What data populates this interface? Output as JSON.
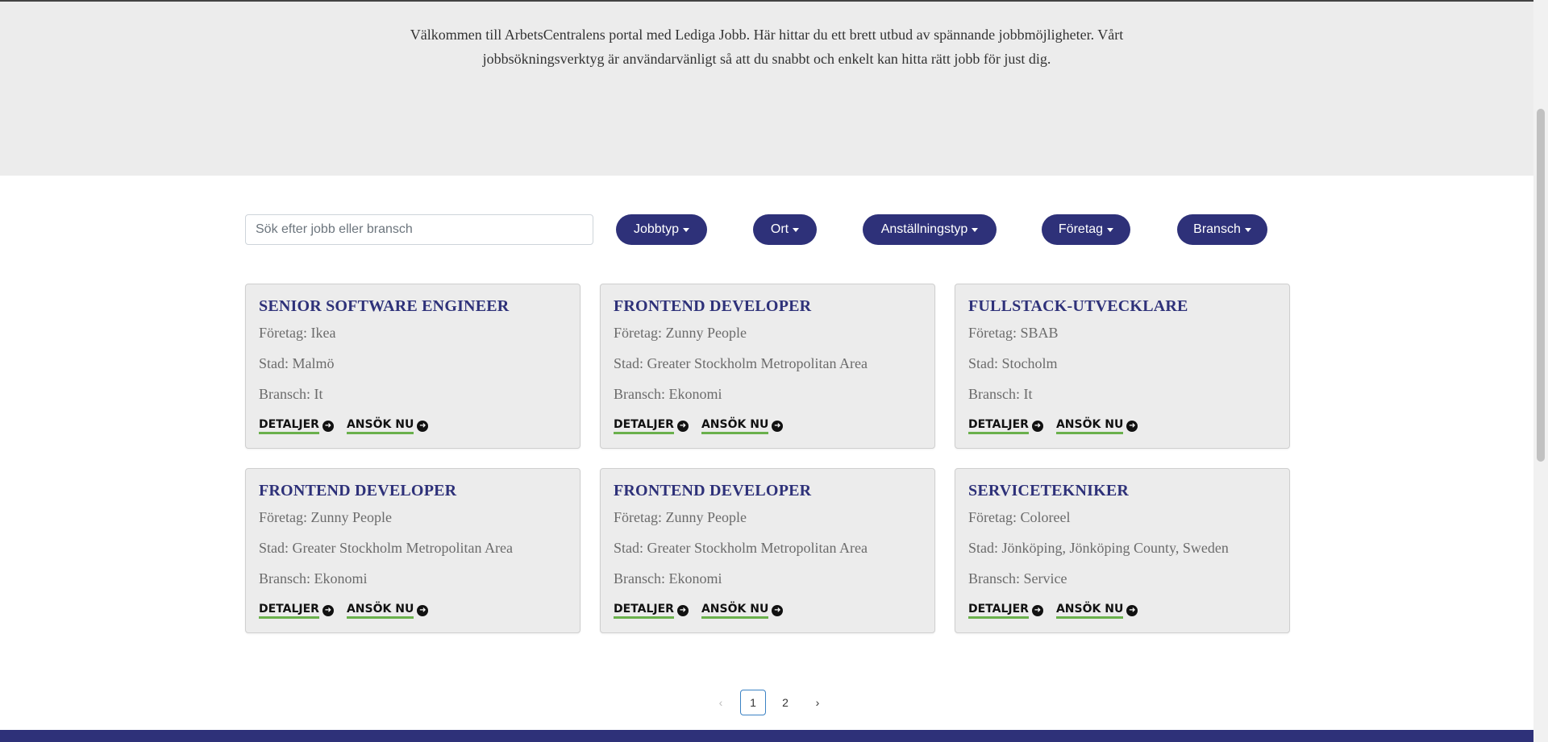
{
  "hero": {
    "text": "Välkommen till ArbetsCentralens portal med Lediga Jobb. Här hittar du ett brett utbud av spännande jobbmöjligheter. Vårt jobbsökningsverktyg är användarvänligt så att du snabbt och enkelt kan hitta rätt jobb för just dig."
  },
  "search": {
    "placeholder": "Sök efter jobb eller bransch",
    "value": ""
  },
  "filters": [
    {
      "label": "Jobbtyp"
    },
    {
      "label": "Ort"
    },
    {
      "label": "Anställningstyp"
    },
    {
      "label": "Företag"
    },
    {
      "label": "Bransch"
    }
  ],
  "labels": {
    "company": "Företag:",
    "city": "Stad:",
    "industry": "Bransch:",
    "details": "DETALJER",
    "apply": "ANSÖK NU"
  },
  "jobs": [
    {
      "title": "SENIOR SOFTWARE ENGINEER",
      "company": "Ikea",
      "city": "Malmö",
      "industry": "It"
    },
    {
      "title": "FRONTEND DEVELOPER",
      "company": "Zunny People",
      "city": "Greater Stockholm Metropolitan Area",
      "industry": "Ekonomi"
    },
    {
      "title": "FULLSTACK-UTVECKLARE",
      "company": "SBAB",
      "city": "Stocholm",
      "industry": "It"
    },
    {
      "title": "FRONTEND DEVELOPER",
      "company": "Zunny People",
      "city": "Greater Stockholm Metropolitan Area",
      "industry": "Ekonomi"
    },
    {
      "title": "FRONTEND DEVELOPER",
      "company": "Zunny People",
      "city": "Greater Stockholm Metropolitan Area",
      "industry": "Ekonomi"
    },
    {
      "title": "SERVICETEKNIKER",
      "company": "Coloreel",
      "city": "Jönköping, Jönköping County, Sweden",
      "industry": "Service"
    }
  ],
  "pagination": {
    "prev": "‹",
    "pages": [
      "1",
      "2"
    ],
    "current": "1",
    "next": "›"
  },
  "colors": {
    "brand": "#2e3179",
    "accent_underline": "#6ab04c",
    "hero_bg": "#ececec"
  }
}
